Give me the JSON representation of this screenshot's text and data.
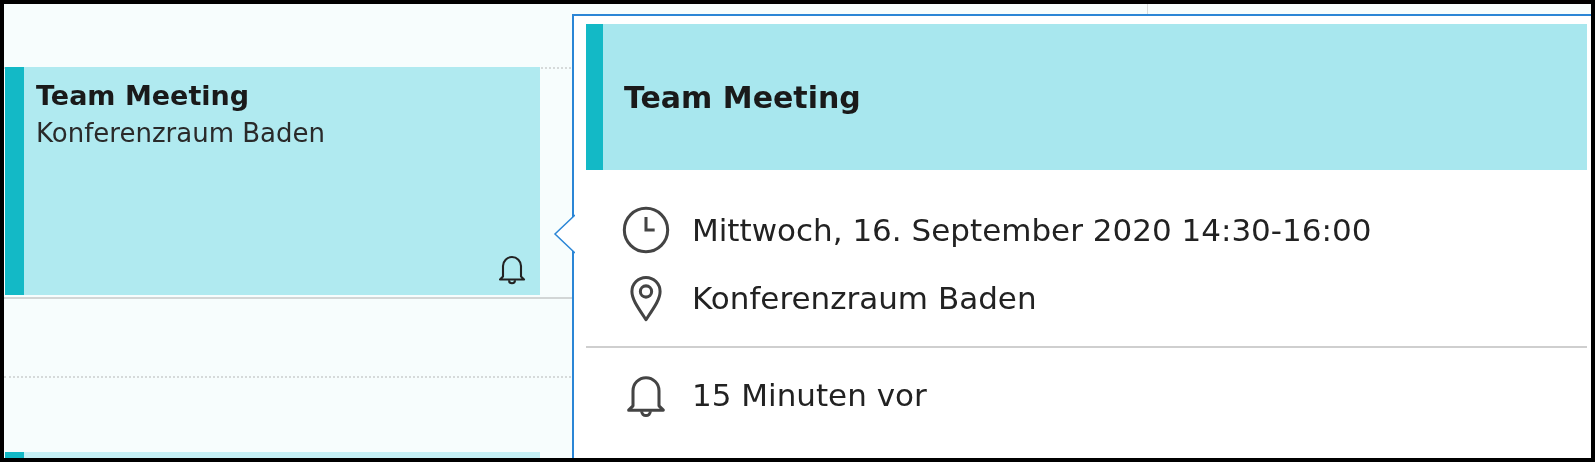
{
  "calendar": {
    "events": [
      {
        "title": "Team Meeting",
        "location": "Konferenzraum Baden",
        "reminder": true,
        "selected": true
      },
      {
        "selected": false
      }
    ]
  },
  "popup": {
    "title": "Team Meeting",
    "details": [
      {
        "kind": "time",
        "text": "Mittwoch, 16. September 2020 14:30-16:00"
      },
      {
        "kind": "location",
        "text": "Konferenzraum Baden"
      },
      {
        "kind": "reminder",
        "text": "15 Minuten vor"
      }
    ]
  }
}
